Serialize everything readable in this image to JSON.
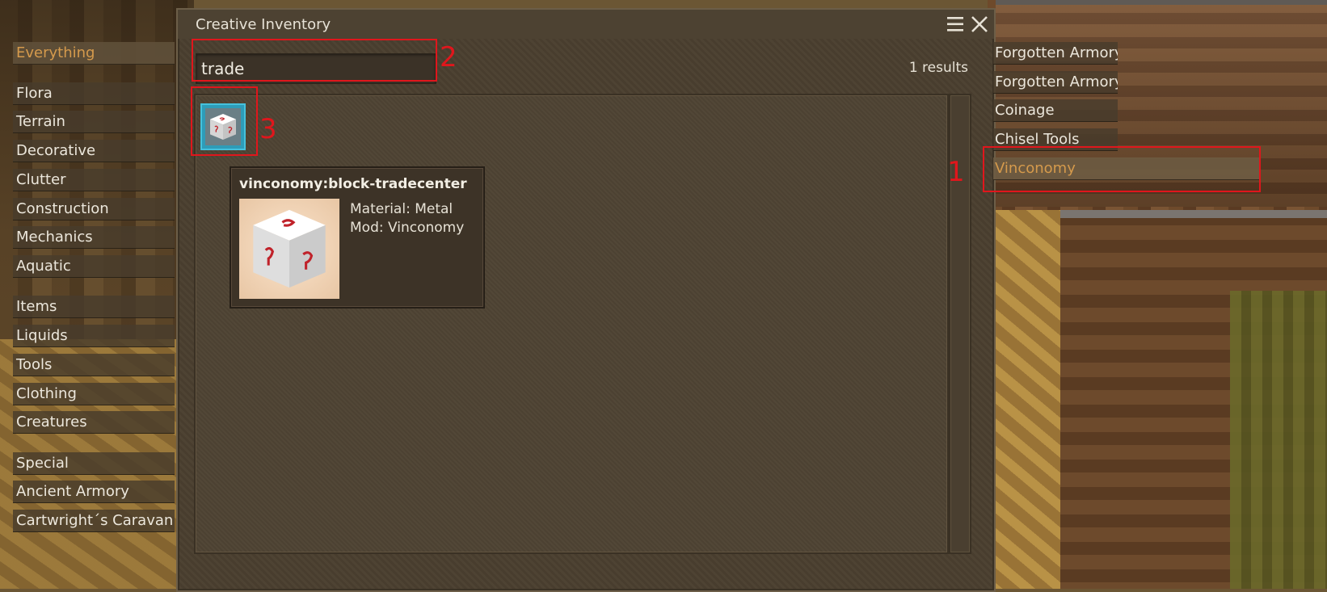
{
  "window": {
    "title": "Creative Inventory"
  },
  "search": {
    "value": "trade",
    "results_text": "1 results"
  },
  "categories": [
    {
      "label": "Everything",
      "active": true
    },
    {
      "label": "Flora"
    },
    {
      "label": "Terrain"
    },
    {
      "label": "Decorative"
    },
    {
      "label": "Clutter"
    },
    {
      "label": "Construction"
    },
    {
      "label": "Mechanics"
    },
    {
      "label": "Aquatic"
    },
    {
      "label": "Items"
    },
    {
      "label": "Liquids"
    },
    {
      "label": "Tools"
    },
    {
      "label": "Clothing"
    },
    {
      "label": "Creatures"
    },
    {
      "label": "Special"
    },
    {
      "label": "Ancient Armory"
    },
    {
      "label": "Cartwright´s Caravan"
    }
  ],
  "mod_tabs": [
    {
      "label": "Forgotten Armory"
    },
    {
      "label": "Forgotten Armory"
    },
    {
      "label": "Coinage"
    },
    {
      "label": "Chisel Tools"
    },
    {
      "label": "Vinconomy",
      "active": true
    }
  ],
  "tooltip": {
    "code": "vinconomy:block-tradecenter",
    "material": "Material: Metal",
    "mod": "Mod: Vinconomy"
  },
  "annotations": [
    "1",
    "2",
    "3"
  ],
  "colors": {
    "active_text": "#d59a4c",
    "annotation": "#e0161c",
    "slot_highlight": "#2e9cb8"
  }
}
